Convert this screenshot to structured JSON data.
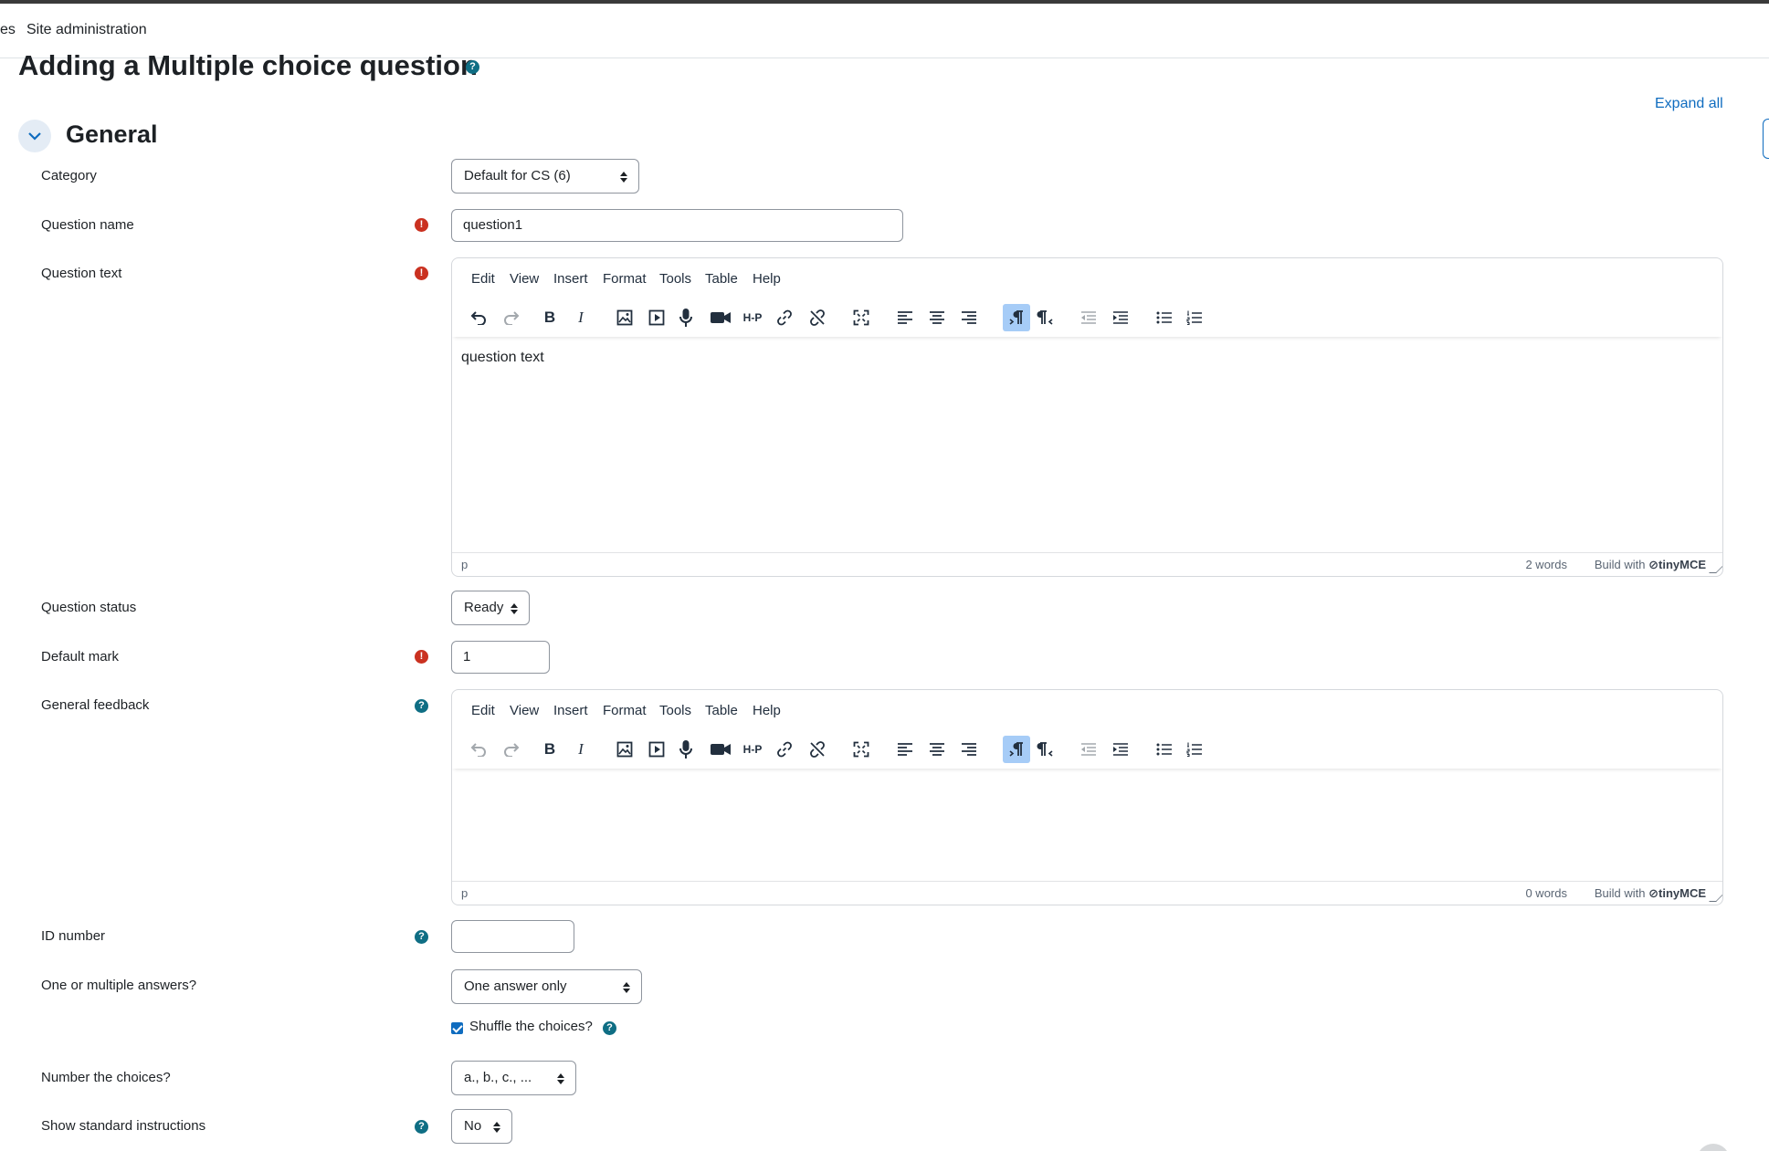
{
  "nav": {
    "items": [
      "es",
      "Site administration"
    ]
  },
  "page": {
    "title": "Adding a Multiple choice question",
    "expand_all": "Expand all"
  },
  "section": {
    "title": "General"
  },
  "form": {
    "category": {
      "label": "Category",
      "value": "Default for CS (6)"
    },
    "question_name": {
      "label": "Question name",
      "value": "question1"
    },
    "question_text": {
      "label": "Question text",
      "content": "question text",
      "status_path": "p",
      "word_count": "2 words"
    },
    "question_status": {
      "label": "Question status",
      "value": "Ready"
    },
    "default_mark": {
      "label": "Default mark",
      "value": "1"
    },
    "general_feedback": {
      "label": "General feedback",
      "content": "",
      "status_path": "p",
      "word_count": "0 words"
    },
    "id_number": {
      "label": "ID number",
      "value": ""
    },
    "single": {
      "label": "One or multiple answers?",
      "value": "One answer only"
    },
    "shuffle": {
      "label": "Shuffle the choices?",
      "checked": true
    },
    "number_choices": {
      "label": "Number the choices?",
      "value": "a., b., c., ..."
    },
    "show_instructions": {
      "label": "Show standard instructions",
      "value": "No"
    }
  },
  "editor": {
    "menu": [
      "Edit",
      "View",
      "Insert",
      "Format",
      "Tools",
      "Table",
      "Help"
    ],
    "brand_prefix": "Build with",
    "brand_name": "tinyMCE"
  },
  "icons": {
    "help": "?",
    "required": "!",
    "bold": "B",
    "italic": "I",
    "h5p": "H-P"
  },
  "colors": {
    "help": "#0f6e84",
    "required": "#ca3120",
    "link": "#0f6cbf",
    "active_tool": "#a6ccf7"
  }
}
